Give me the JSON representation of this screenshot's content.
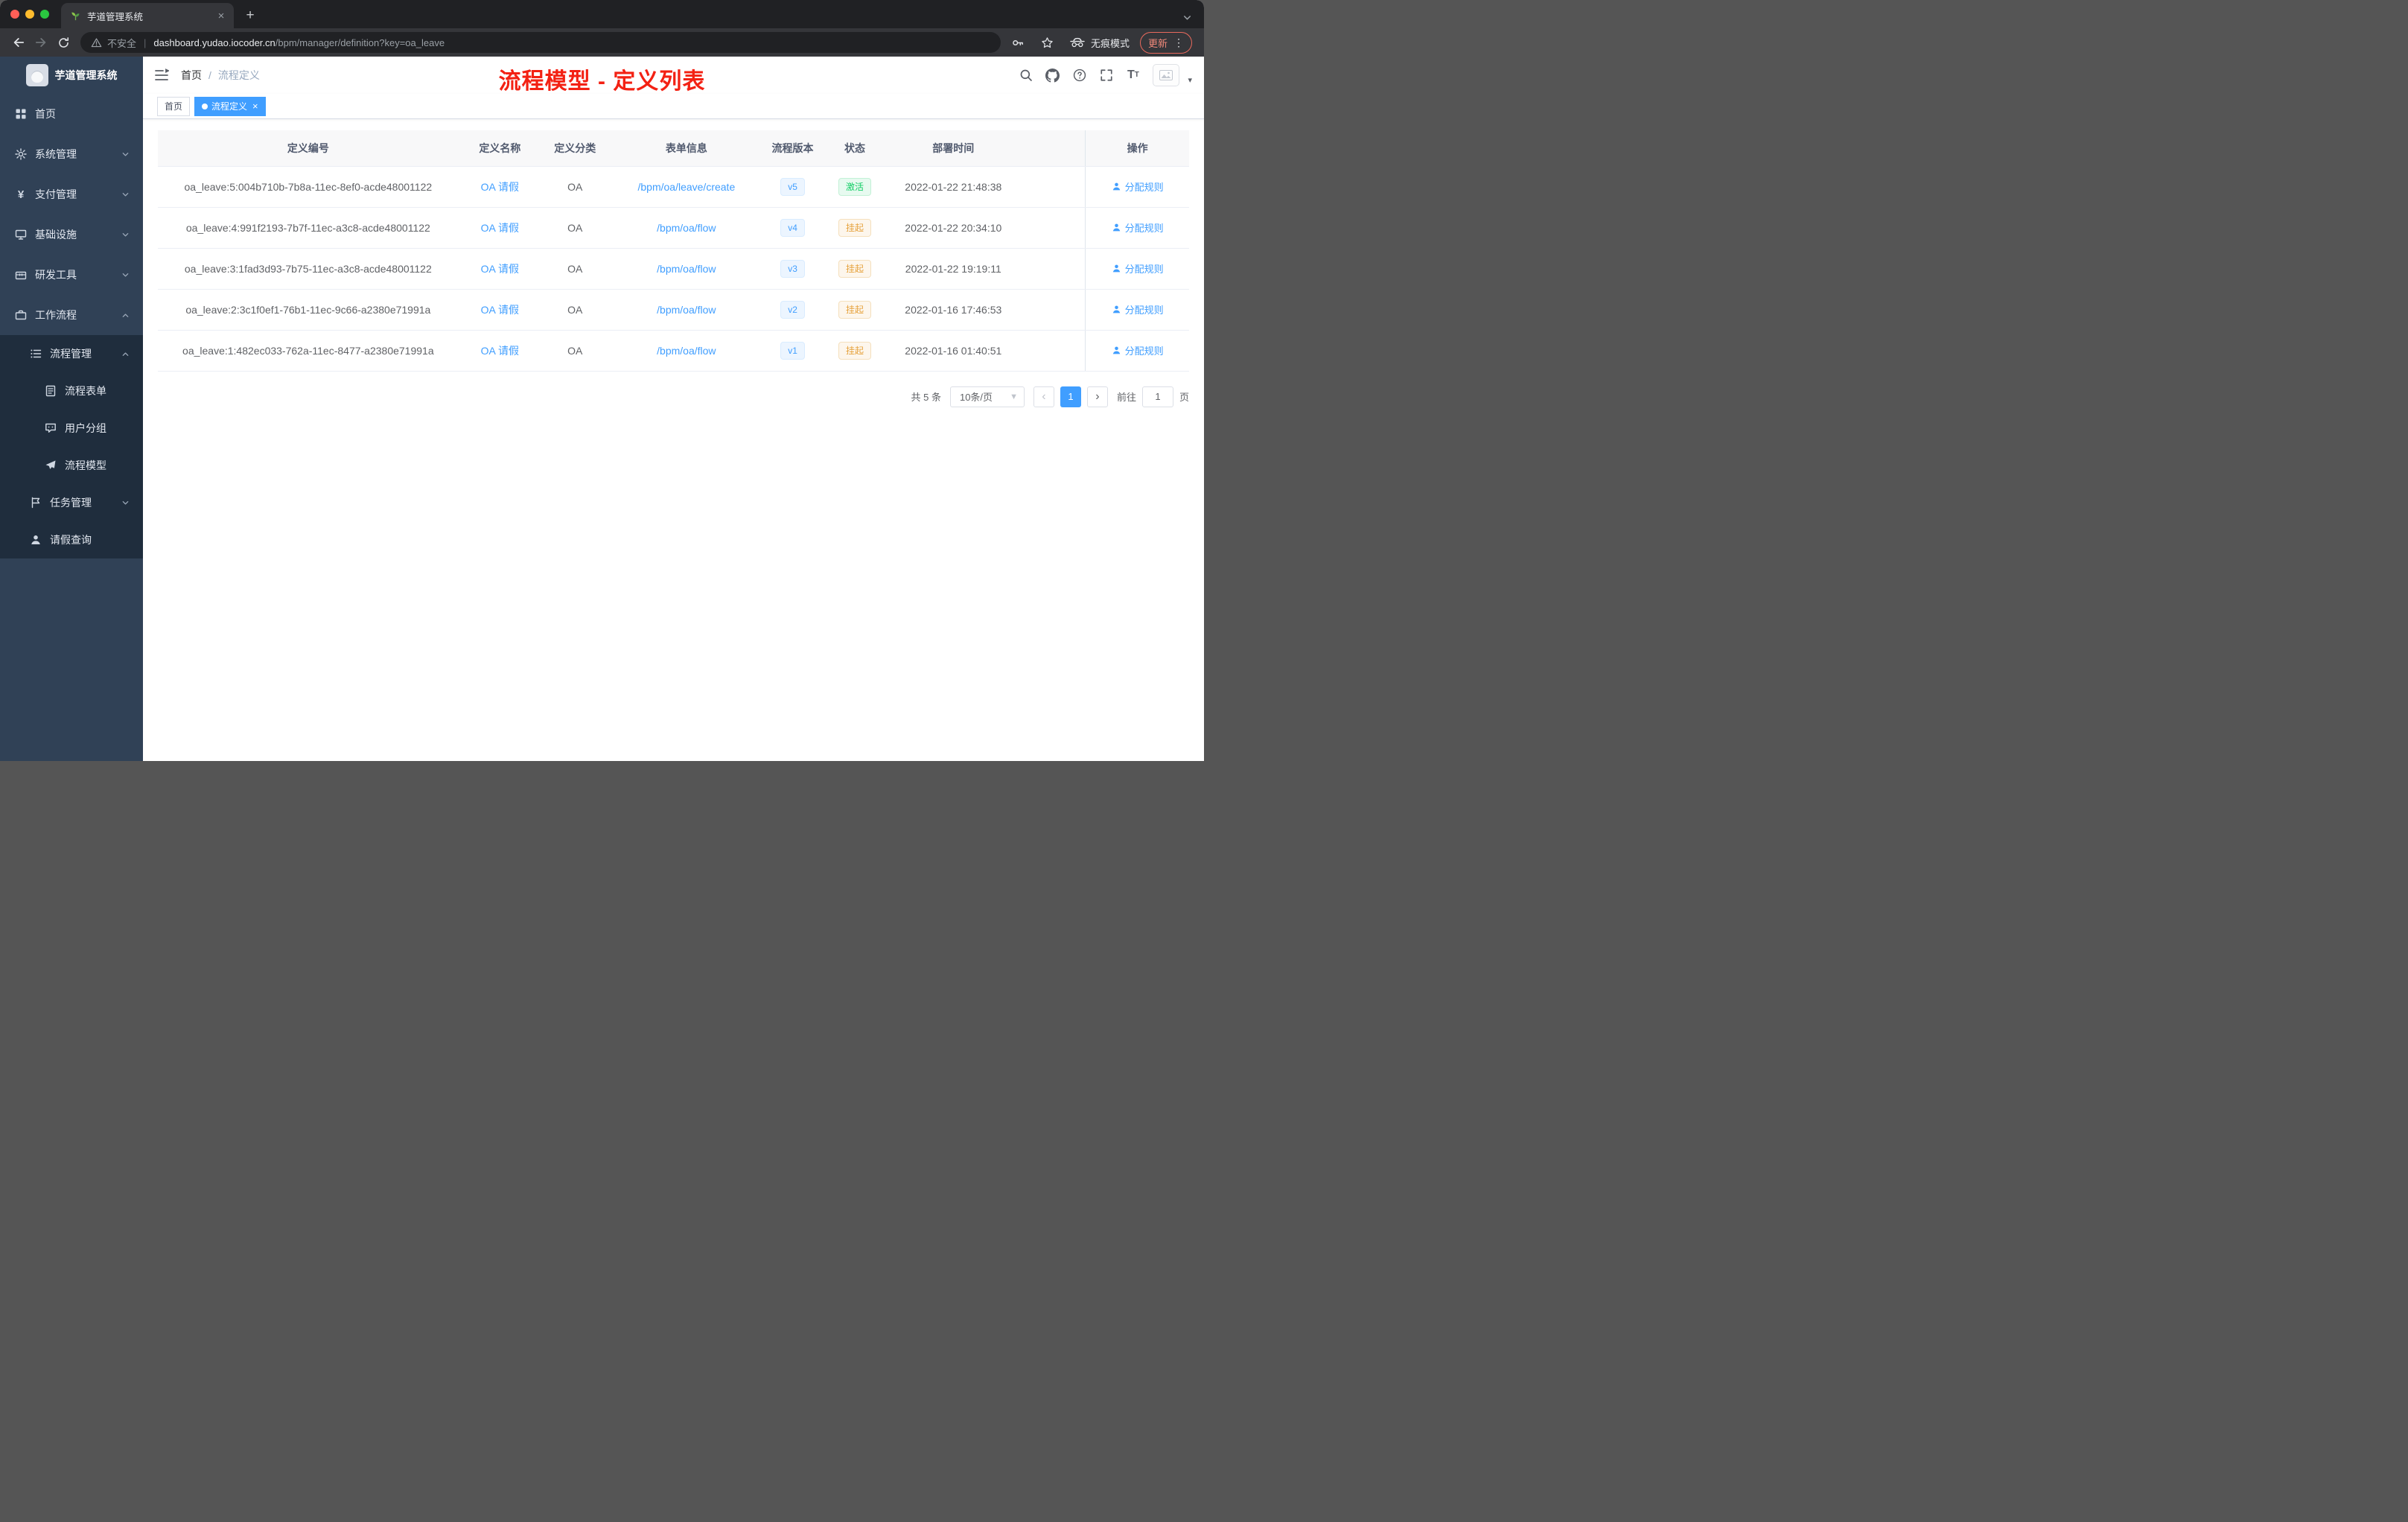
{
  "browser": {
    "tab": {
      "title": "芋道管理系统"
    },
    "toolbar": {
      "security_label": "不安全",
      "url_host": "dashboard.yudao.iocoder.cn",
      "url_path": "/bpm/manager/definition?key=oa_leave",
      "incognito_label": "无痕模式",
      "update_label": "更新"
    }
  },
  "annotation": {
    "title": "流程模型 - 定义列表",
    "color": "#f32113"
  },
  "sidebar": {
    "title": "芋道管理系统",
    "items": [
      {
        "label": "首页",
        "icon": "dashboard-icon"
      },
      {
        "label": "系统管理",
        "icon": "gear-icon"
      },
      {
        "label": "支付管理",
        "icon": "yen-icon"
      },
      {
        "label": "基础设施",
        "icon": "monitor-icon"
      },
      {
        "label": "研发工具",
        "icon": "toolbox-icon"
      },
      {
        "label": "工作流程",
        "icon": "briefcase-icon"
      },
      {
        "label": "流程管理",
        "icon": "list-icon"
      },
      {
        "label": "流程表单",
        "icon": "form-icon"
      },
      {
        "label": "用户分组",
        "icon": "user-group-icon"
      },
      {
        "label": "流程模型",
        "icon": "paper-plane-icon"
      },
      {
        "label": "任务管理",
        "icon": "flag-icon"
      },
      {
        "label": "请假查询",
        "icon": "person-icon"
      }
    ]
  },
  "header": {
    "breadcrumb": {
      "root": "首页",
      "separator": "/",
      "current": "流程定义"
    }
  },
  "tags": [
    {
      "label": "首页",
      "active": false
    },
    {
      "label": "流程定义",
      "active": true
    }
  ],
  "table": {
    "columns": [
      "定义编号",
      "定义名称",
      "定义分类",
      "表单信息",
      "流程版本",
      "状态",
      "部署时间",
      "操作"
    ],
    "rows": [
      {
        "id": "oa_leave:5:004b710b-7b8a-11ec-8ef0-acde48001122",
        "name": "OA 请假",
        "category": "OA",
        "form": "/bpm/oa/leave/create",
        "version": "v5",
        "status": "激活",
        "status_type": "success",
        "deploy_time": "2022-01-22 21:48:38",
        "action": "分配规则"
      },
      {
        "id": "oa_leave:4:991f2193-7b7f-11ec-a3c8-acde48001122",
        "name": "OA 请假",
        "category": "OA",
        "form": "/bpm/oa/flow",
        "version": "v4",
        "status": "挂起",
        "status_type": "warning",
        "deploy_time": "2022-01-22 20:34:10",
        "action": "分配规则"
      },
      {
        "id": "oa_leave:3:1fad3d93-7b75-11ec-a3c8-acde48001122",
        "name": "OA 请假",
        "category": "OA",
        "form": "/bpm/oa/flow",
        "version": "v3",
        "status": "挂起",
        "status_type": "warning",
        "deploy_time": "2022-01-22 19:19:11",
        "action": "分配规则"
      },
      {
        "id": "oa_leave:2:3c1f0ef1-76b1-11ec-9c66-a2380e71991a",
        "name": "OA 请假",
        "category": "OA",
        "form": "/bpm/oa/flow",
        "version": "v2",
        "status": "挂起",
        "status_type": "warning",
        "deploy_time": "2022-01-16 17:46:53",
        "action": "分配规则"
      },
      {
        "id": "oa_leave:1:482ec033-762a-11ec-8477-a2380e71991a",
        "name": "OA 请假",
        "category": "OA",
        "form": "/bpm/oa/flow",
        "version": "v1",
        "status": "挂起",
        "status_type": "warning",
        "deploy_time": "2022-01-16 01:40:51",
        "action": "分配规则"
      }
    ]
  },
  "pagination": {
    "total_label": "共 5 条",
    "page_size_label": "10条/页",
    "current_page": "1",
    "goto_label": "前往",
    "goto_value": "1",
    "page_unit": "页"
  },
  "colors": {
    "accent": "#409eff",
    "success": "#13ce66",
    "warning": "#e6a23c",
    "sidebar_bg": "#304156",
    "submenu_bg": "#1f2d3d",
    "annotation_red": "#f32113"
  }
}
